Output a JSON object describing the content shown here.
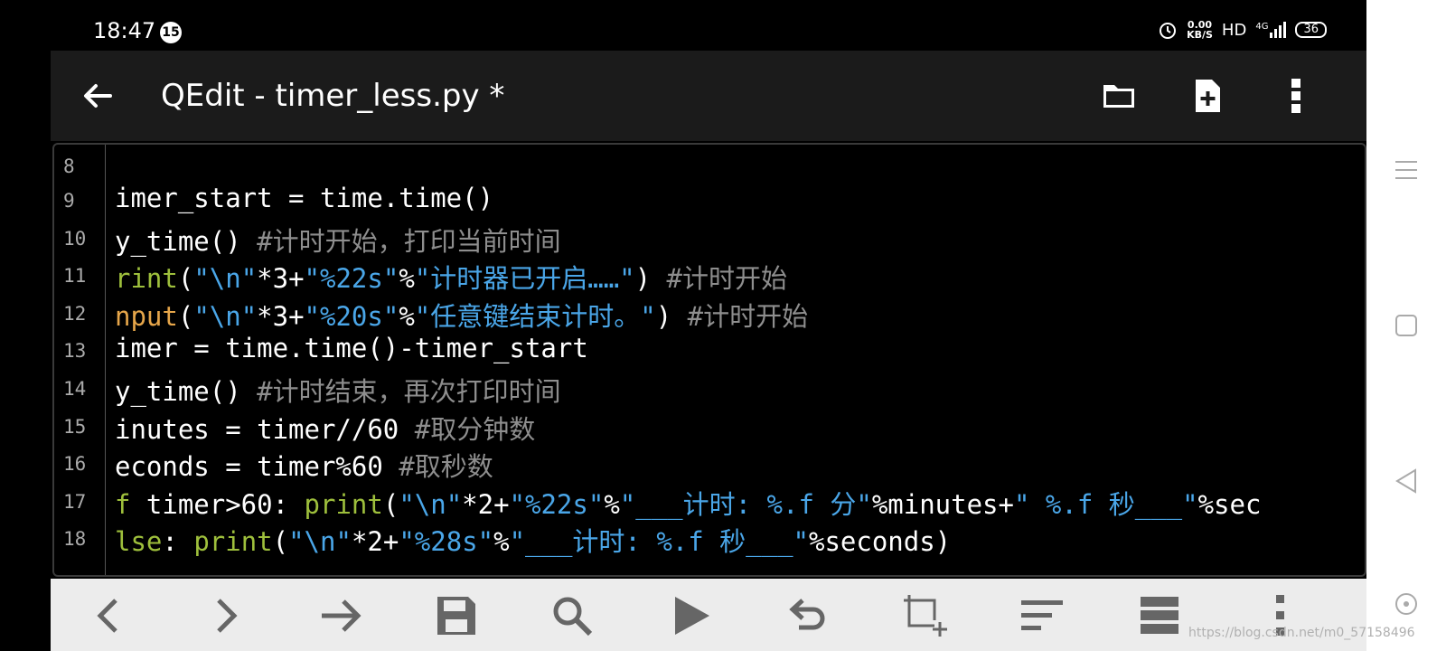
{
  "status_bar": {
    "time": "18:47",
    "notification_count": "15",
    "net_speed_top": "0.00",
    "net_speed_unit": "KB/S",
    "hd_label": "HD",
    "signal_label": "4G",
    "battery": "36"
  },
  "app_bar": {
    "title": "QEdit - timer_less.py *"
  },
  "editor": {
    "lines": [
      {
        "num": "8",
        "code": ""
      },
      {
        "num": "9",
        "code": "imer_start = time.time()"
      },
      {
        "num": "10",
        "code": "y_time() #计时开始，打印当前时间"
      },
      {
        "num": "11",
        "code": "rint(\"\\n\"*3+\"%22s\"%\"计时器已开启……\") #计时开始"
      },
      {
        "num": "12",
        "code": "nput(\"\\n\"*3+\"%20s\"%\"任意键结束计时。\") #计时开始"
      },
      {
        "num": "13",
        "code": "imer = time.time()-timer_start"
      },
      {
        "num": "14",
        "code": "y_time() #计时结束，再次打印时间"
      },
      {
        "num": "15",
        "code": "inutes = timer//60 #取分钟数"
      },
      {
        "num": "16",
        "code": "econds = timer%60 #取秒数"
      },
      {
        "num": "17",
        "code": "f timer>60: print(\"\\n\"*2+\"%22s\"%\"___计时: %.f 分\"%minutes+\" %.f 秒___\"%sec"
      },
      {
        "num": "18",
        "code": "lse: print(\"\\n\"*2+\"%28s\"%\"___计时: %.f 秒___\"%seconds)"
      }
    ]
  },
  "toolbar": {
    "icons": [
      "chevron-left-icon",
      "chevron-right-icon",
      "arrow-right-icon",
      "save-icon",
      "search-icon",
      "play-icon",
      "undo-icon",
      "crop-add-icon",
      "sort-lines-icon",
      "list-icon",
      "more-vert-icon"
    ]
  },
  "watermark": "https://blog.csdn.net/m0_57158496",
  "colors": {
    "string": "#4aa6e8",
    "comment": "#8e8e8e",
    "builtin": "#9ebf3c",
    "input_builtin": "#e6a64a",
    "appbar": "#1b1b1b",
    "toolbar": "#ececec"
  }
}
